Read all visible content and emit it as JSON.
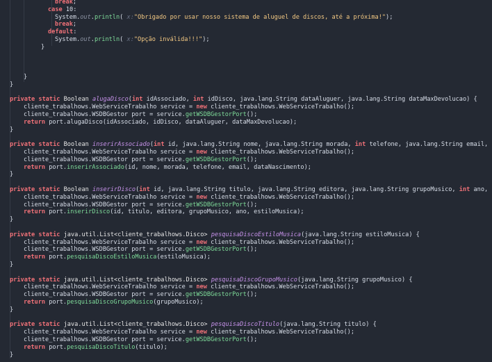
{
  "editor": {
    "language": "java",
    "colors": {
      "background": "#242933",
      "keyword": "#f07178",
      "method_decl": "#c792ea",
      "method_call": "#7fdc9a",
      "string": "#f4c983",
      "text": "#d8dee9",
      "hint": "#6b7386"
    },
    "lines": [
      {
        "indent": 13,
        "tokens": [
          {
            "t": "kw",
            "v": "break"
          },
          {
            "t": "pl",
            "v": ";"
          }
        ]
      },
      {
        "indent": 11,
        "tokens": [
          {
            "t": "kw",
            "v": "case"
          },
          {
            "t": "pl",
            "v": " 10:"
          }
        ]
      },
      {
        "indent": 13,
        "tokens": [
          {
            "t": "pl",
            "v": "System."
          },
          {
            "t": "dot-o",
            "v": "out"
          },
          {
            "t": "pl",
            "v": "."
          },
          {
            "t": "m",
            "v": "println"
          },
          {
            "t": "pl",
            "v": "( "
          },
          {
            "t": "hint",
            "v": "x:"
          },
          {
            "t": "st",
            "v": "\"Obrigado por usar nosso sistema de aluguel de discos, até a próxima!\""
          },
          {
            "t": "pl",
            "v": ");"
          }
        ]
      },
      {
        "indent": 13,
        "tokens": [
          {
            "t": "kw",
            "v": "break"
          },
          {
            "t": "pl",
            "v": ";"
          }
        ]
      },
      {
        "indent": 11,
        "tokens": [
          {
            "t": "kw",
            "v": "default"
          },
          {
            "t": "pl",
            "v": ":"
          }
        ]
      },
      {
        "indent": 13,
        "tokens": [
          {
            "t": "pl",
            "v": "System."
          },
          {
            "t": "dot-o",
            "v": "out"
          },
          {
            "t": "pl",
            "v": "."
          },
          {
            "t": "m",
            "v": "println"
          },
          {
            "t": "pl",
            "v": "( "
          },
          {
            "t": "hint",
            "v": "x:"
          },
          {
            "t": "st",
            "v": "\"Opção inválida!!!\""
          },
          {
            "t": "pl",
            "v": ");"
          }
        ]
      },
      {
        "indent": 9,
        "tokens": [
          {
            "t": "pl",
            "v": "}"
          }
        ]
      },
      {
        "indent": 0,
        "tokens": []
      },
      {
        "indent": 0,
        "tokens": []
      },
      {
        "indent": 0,
        "tokens": []
      },
      {
        "indent": 4,
        "tokens": [
          {
            "t": "pl",
            "v": "}"
          }
        ]
      },
      {
        "indent": 0,
        "tokens": [
          {
            "t": "pl",
            "v": "}"
          }
        ]
      },
      {
        "indent": 0,
        "tokens": []
      },
      {
        "indent": 0,
        "tokens": [
          {
            "t": "kw",
            "v": "private static"
          },
          {
            "t": "ty",
            "v": " Boolean "
          },
          {
            "t": "fn",
            "v": "alugaDisco"
          },
          {
            "t": "pl",
            "v": "("
          },
          {
            "t": "kw",
            "v": "int"
          },
          {
            "t": "pl",
            "v": " idAssociado, "
          },
          {
            "t": "kw",
            "v": "int"
          },
          {
            "t": "pl",
            "v": " idDisco, java.lang.String dataAluguer, java.lang.String dataMaxDevolucao) {"
          }
        ]
      },
      {
        "indent": 4,
        "tokens": [
          {
            "t": "pl",
            "v": "cliente_trabalhows.WebServiceTrabalho service = "
          },
          {
            "t": "kw",
            "v": "new"
          },
          {
            "t": "pl",
            "v": " cliente_trabalhows.WebServiceTrabalho();"
          }
        ]
      },
      {
        "indent": 4,
        "tokens": [
          {
            "t": "pl",
            "v": "cliente_trabalhows.WSDBGestor port = service."
          },
          {
            "t": "m",
            "v": "getWSDBGestorPort"
          },
          {
            "t": "pl",
            "v": "();"
          }
        ]
      },
      {
        "indent": 4,
        "tokens": [
          {
            "t": "kw",
            "v": "return"
          },
          {
            "t": "pl",
            "v": " port.alugaDisco(idAssociado, idDisco, dataAluguer, dataMaxDevolucao);"
          }
        ]
      },
      {
        "indent": 0,
        "tokens": [
          {
            "t": "pl",
            "v": "}"
          }
        ]
      },
      {
        "indent": 0,
        "tokens": []
      },
      {
        "indent": 0,
        "tokens": [
          {
            "t": "kw",
            "v": "private static"
          },
          {
            "t": "ty",
            "v": " Boolean "
          },
          {
            "t": "fn",
            "v": "inserirAssociado"
          },
          {
            "t": "pl",
            "v": "("
          },
          {
            "t": "kw",
            "v": "int"
          },
          {
            "t": "pl",
            "v": " id, java.lang.String nome, java.lang.String morada, "
          },
          {
            "t": "kw",
            "v": "int"
          },
          {
            "t": "pl",
            "v": " telefone, java.lang.String email, java.l"
          }
        ]
      },
      {
        "indent": 4,
        "tokens": [
          {
            "t": "pl",
            "v": "cliente_trabalhows.WebServiceTrabalho service = "
          },
          {
            "t": "kw",
            "v": "new"
          },
          {
            "t": "pl",
            "v": " cliente_trabalhows.WebServiceTrabalho();"
          }
        ]
      },
      {
        "indent": 4,
        "tokens": [
          {
            "t": "pl",
            "v": "cliente_trabalhows.WSDBGestor port = service."
          },
          {
            "t": "m",
            "v": "getWSDBGestorPort"
          },
          {
            "t": "pl",
            "v": "();"
          }
        ]
      },
      {
        "indent": 4,
        "tokens": [
          {
            "t": "kw",
            "v": "return"
          },
          {
            "t": "pl",
            "v": " port."
          },
          {
            "t": "m",
            "v": "inserirAssociado"
          },
          {
            "t": "pl",
            "v": "(id, nome, morada, telefone, email, dataNascimento);"
          }
        ]
      },
      {
        "indent": 0,
        "tokens": [
          {
            "t": "pl",
            "v": "}"
          }
        ]
      },
      {
        "indent": 0,
        "tokens": []
      },
      {
        "indent": 0,
        "tokens": [
          {
            "t": "kw",
            "v": "private static"
          },
          {
            "t": "ty",
            "v": " Boolean "
          },
          {
            "t": "fn",
            "v": "inserirDisco"
          },
          {
            "t": "pl",
            "v": "("
          },
          {
            "t": "kw",
            "v": "int"
          },
          {
            "t": "pl",
            "v": " id, java.lang.String titulo, java.lang.String editora, java.lang.String grupoMusico, "
          },
          {
            "t": "kw",
            "v": "int"
          },
          {
            "t": "pl",
            "v": " ano, java.l"
          }
        ]
      },
      {
        "indent": 4,
        "tokens": [
          {
            "t": "pl",
            "v": "cliente_trabalhows.WebServiceTrabalho service = "
          },
          {
            "t": "kw",
            "v": "new"
          },
          {
            "t": "pl",
            "v": " cliente_trabalhows.WebServiceTrabalho();"
          }
        ]
      },
      {
        "indent": 4,
        "tokens": [
          {
            "t": "pl",
            "v": "cliente_trabalhows.WSDBGestor port = service."
          },
          {
            "t": "m",
            "v": "getWSDBGestorPort"
          },
          {
            "t": "pl",
            "v": "();"
          }
        ]
      },
      {
        "indent": 4,
        "tokens": [
          {
            "t": "kw",
            "v": "return"
          },
          {
            "t": "pl",
            "v": " port."
          },
          {
            "t": "m",
            "v": "inserirDisco"
          },
          {
            "t": "pl",
            "v": "(id, titulo, editora, grupoMusico, ano, estiloMusica);"
          }
        ]
      },
      {
        "indent": 0,
        "tokens": [
          {
            "t": "pl",
            "v": "}"
          }
        ]
      },
      {
        "indent": 0,
        "tokens": []
      },
      {
        "indent": 0,
        "tokens": [
          {
            "t": "kw",
            "v": "private static"
          },
          {
            "t": "ty",
            "v": " java.util.List<cliente_trabalhows.Disco> "
          },
          {
            "t": "fn",
            "v": "pesquisaDiscoEstiloMusica"
          },
          {
            "t": "pl",
            "v": "(java.lang.String estiloMusica) {"
          }
        ]
      },
      {
        "indent": 4,
        "tokens": [
          {
            "t": "pl",
            "v": "cliente_trabalhows.WebServiceTrabalho service = "
          },
          {
            "t": "kw",
            "v": "new"
          },
          {
            "t": "pl",
            "v": " cliente_trabalhows.WebServiceTrabalho();"
          }
        ]
      },
      {
        "indent": 4,
        "tokens": [
          {
            "t": "pl",
            "v": "cliente_trabalhows.WSDBGestor port = service."
          },
          {
            "t": "m",
            "v": "getWSDBGestorPort"
          },
          {
            "t": "pl",
            "v": "();"
          }
        ]
      },
      {
        "indent": 4,
        "tokens": [
          {
            "t": "kw",
            "v": "return"
          },
          {
            "t": "pl",
            "v": " port."
          },
          {
            "t": "m",
            "v": "pesquisaDiscoEstiloMusica"
          },
          {
            "t": "pl",
            "v": "(estiloMusica);"
          }
        ]
      },
      {
        "indent": 0,
        "tokens": [
          {
            "t": "pl",
            "v": "}"
          }
        ]
      },
      {
        "indent": 0,
        "tokens": []
      },
      {
        "indent": 0,
        "tokens": [
          {
            "t": "kw",
            "v": "private static"
          },
          {
            "t": "ty",
            "v": " java.util.List<cliente_trabalhows.Disco> "
          },
          {
            "t": "fn",
            "v": "pesquisaDiscoGrupoMusico"
          },
          {
            "t": "pl",
            "v": "(java.lang.String grupoMusico) {"
          }
        ]
      },
      {
        "indent": 4,
        "tokens": [
          {
            "t": "pl",
            "v": "cliente_trabalhows.WebServiceTrabalho service = "
          },
          {
            "t": "kw",
            "v": "new"
          },
          {
            "t": "pl",
            "v": " cliente_trabalhows.WebServiceTrabalho();"
          }
        ]
      },
      {
        "indent": 4,
        "tokens": [
          {
            "t": "pl",
            "v": "cliente_trabalhows.WSDBGestor port = service."
          },
          {
            "t": "m",
            "v": "getWSDBGestorPort"
          },
          {
            "t": "pl",
            "v": "();"
          }
        ]
      },
      {
        "indent": 4,
        "tokens": [
          {
            "t": "kw",
            "v": "return"
          },
          {
            "t": "pl",
            "v": " port."
          },
          {
            "t": "m",
            "v": "pesquisaDiscoGrupoMusico"
          },
          {
            "t": "pl",
            "v": "(grupoMusico);"
          }
        ]
      },
      {
        "indent": 0,
        "tokens": [
          {
            "t": "pl",
            "v": "}"
          }
        ]
      },
      {
        "indent": 0,
        "tokens": []
      },
      {
        "indent": 0,
        "tokens": [
          {
            "t": "kw",
            "v": "private static"
          },
          {
            "t": "ty",
            "v": " java.util.List<cliente_trabalhows.Disco> "
          },
          {
            "t": "fn",
            "v": "pesquisaDiscoTitulo"
          },
          {
            "t": "pl",
            "v": "(java.lang.String titulo) {"
          }
        ]
      },
      {
        "indent": 4,
        "tokens": [
          {
            "t": "pl",
            "v": "cliente_trabalhows.WebServiceTrabalho service = "
          },
          {
            "t": "kw",
            "v": "new"
          },
          {
            "t": "pl",
            "v": " cliente_trabalhows.WebServiceTrabalho();"
          }
        ]
      },
      {
        "indent": 4,
        "tokens": [
          {
            "t": "pl",
            "v": "cliente_trabalhows.WSDBGestor port = service."
          },
          {
            "t": "m",
            "v": "getWSDBGestorPort"
          },
          {
            "t": "pl",
            "v": "();"
          }
        ]
      },
      {
        "indent": 4,
        "tokens": [
          {
            "t": "kw",
            "v": "return"
          },
          {
            "t": "pl",
            "v": " port."
          },
          {
            "t": "m",
            "v": "pesquisaDiscoTitulo"
          },
          {
            "t": "pl",
            "v": "(titulo);"
          }
        ]
      },
      {
        "indent": 0,
        "tokens": [
          {
            "t": "pl",
            "v": "}"
          }
        ]
      }
    ]
  }
}
